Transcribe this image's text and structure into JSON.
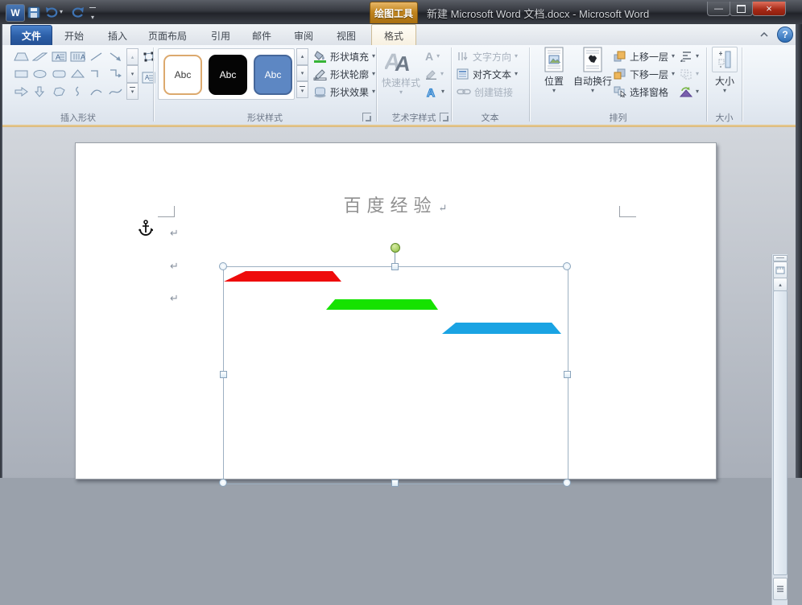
{
  "window": {
    "title": "新建 Microsoft Word 文档.docx  -  Microsoft Word",
    "contextual_tool": "绘图工具",
    "help_glyph": "?",
    "minimize_glyph": "—",
    "close_glyph": "×"
  },
  "tabs": {
    "file": "文件",
    "items": [
      {
        "label": "开始"
      },
      {
        "label": "插入"
      },
      {
        "label": "页面布局"
      },
      {
        "label": "引用"
      },
      {
        "label": "邮件"
      },
      {
        "label": "审阅"
      },
      {
        "label": "视图"
      }
    ],
    "active": "格式"
  },
  "ribbon": {
    "insert_shapes": {
      "label": "插入形状"
    },
    "shape_styles": {
      "label": "形状样式",
      "gallery": [
        {
          "label": "Abc",
          "fill": "#ffffff",
          "border": "#dca96e",
          "text_color": "#3a3a3a"
        },
        {
          "label": "Abc",
          "fill": "#050505",
          "border": "#050505",
          "text_color": "#ffffff"
        },
        {
          "label": "Abc",
          "fill": "#5d87c3",
          "border": "#46679a",
          "text_color": "#ffffff"
        }
      ],
      "fill_label": "形状填充",
      "outline_label": "形状轮廓",
      "effects_label": "形状效果"
    },
    "wordart": {
      "label": "艺术字样式",
      "quick_styles_label": "快速样式"
    },
    "text": {
      "label": "文本",
      "direction_label": "文字方向",
      "align_label": "对齐文本",
      "link_label": "创建链接"
    },
    "arrange": {
      "label": "排列",
      "position_label": "位置",
      "wrap_label": "自动换行",
      "forward_label": "上移一层",
      "backward_label": "下移一层",
      "pane_label": "选择窗格"
    },
    "size": {
      "label": "大小",
      "button_label": "大小"
    }
  },
  "icons": {
    "dropdown_caret": "▾",
    "scroll_up": "▴",
    "scroll_down": "▾",
    "collapse_chevron": "▲"
  },
  "document": {
    "title": "百度经验",
    "pilcrow": "↵",
    "shapes": [
      {
        "name": "red-trapezoid",
        "color": "#ee0b0b"
      },
      {
        "name": "green-trapezoid",
        "color": "#16e200"
      },
      {
        "name": "blue-trapezoid",
        "color": "#1aa3e3"
      }
    ],
    "selection_color": "#9db0c2",
    "rotation_handle_color": "#8cbe3f"
  }
}
